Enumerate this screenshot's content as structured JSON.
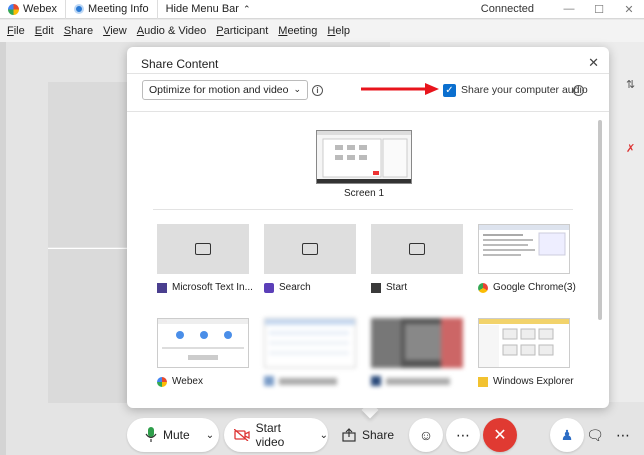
{
  "titlebar": {
    "app_name": "Webex",
    "meeting_info": "Meeting Info",
    "hide_menu": "Hide Menu Bar",
    "status": "Connected"
  },
  "menu": [
    "File",
    "Edit",
    "Share",
    "View",
    "Audio & Video",
    "Participant",
    "Meeting",
    "Help"
  ],
  "dialog": {
    "title": "Share Content",
    "optimize_value": "Optimize for motion and video",
    "share_audio_label": "Share your computer audio",
    "share_audio_checked": true,
    "screen_label": "Screen 1",
    "apps_row1": [
      {
        "label": "Microsoft Text In...",
        "icon": "text-input-icon"
      },
      {
        "label": "Search",
        "icon": "search-app-icon"
      },
      {
        "label": "Start",
        "icon": "start-app-icon"
      },
      {
        "label": "Google Chrome(3)",
        "icon": "chrome-icon"
      }
    ],
    "apps_row2": [
      {
        "label": "Webex",
        "icon": "webex-icon"
      },
      {
        "label": "",
        "icon": "blurred-app-icon"
      },
      {
        "label": "",
        "icon": "blurred-app-icon"
      },
      {
        "label": "Windows Explorer",
        "icon": "explorer-icon"
      }
    ]
  },
  "toolbar": {
    "mute_label": "Mute",
    "video_label": "Start video",
    "share_label": "Share"
  },
  "colors": {
    "accent": "#0b6fcf",
    "leave": "#e03a32",
    "arrow": "#e8141c"
  }
}
